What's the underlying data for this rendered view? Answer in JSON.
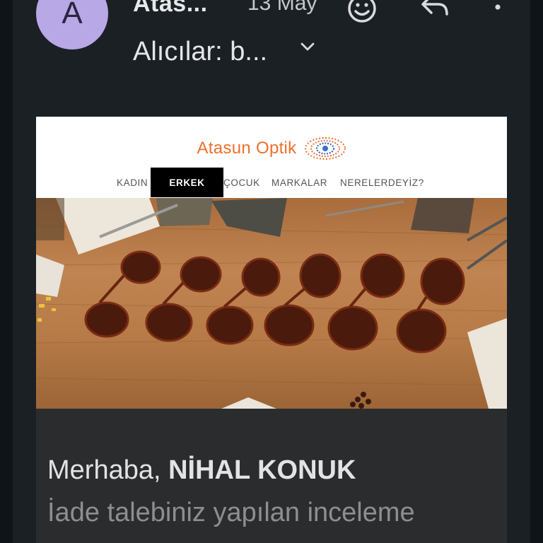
{
  "header": {
    "avatar_letter": "A",
    "sender": "Atas...",
    "date": "13 May",
    "recipients_label": "Alıcılar: b...",
    "icons": [
      "emoji-icon",
      "reply-icon",
      "more-vert-icon",
      "chevron-down-icon"
    ]
  },
  "email": {
    "brand": "Atasun Optik",
    "nav": {
      "kadin": "KADIN",
      "erkek": "ERKEK",
      "cocuk": "ÇOCUK",
      "markalar": "MARKALAR",
      "nerelerdeyiz": "NERELERDEYİZ?"
    },
    "greeting_prefix": "Merhaba,",
    "greeting_name": "NİHAL KONUK",
    "body_line": "İade talebiniz yapılan inceleme",
    "colors": {
      "brand_orange": "#ee6f2d",
      "brand_blue": "#3b6fc7",
      "avatar": "#b9a8e6"
    }
  }
}
